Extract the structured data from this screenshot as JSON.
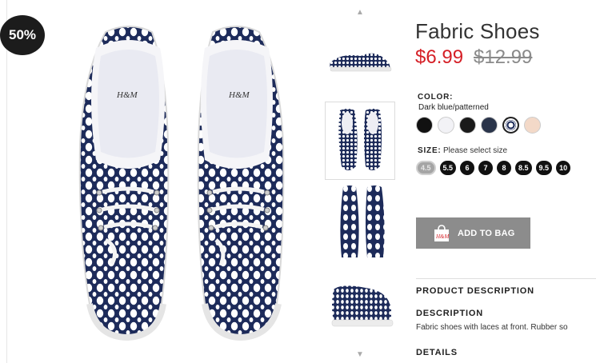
{
  "badge": {
    "label": "50%"
  },
  "product": {
    "title": "Fabric Shoes",
    "price_sale": "$6.99",
    "price_original": "$12.99"
  },
  "color": {
    "heading": "COLOR:",
    "selected_name": "Dark blue/patterned",
    "swatches": [
      "#111111",
      "#f2f2f6",
      "#1a1a1a",
      "#2a344a",
      "patterned-navy",
      "#f3d9c8"
    ]
  },
  "size": {
    "heading": "SIZE:",
    "hint": "Please select size",
    "options": [
      "4.5",
      "5.5",
      "6",
      "7",
      "8",
      "8.5",
      "9.5",
      "10"
    ]
  },
  "actions": {
    "add_to_bag_label": "ADD TO BAG",
    "bag_logo_text": "H&M"
  },
  "sections": {
    "product_description_heading": "PRODUCT DESCRIPTION",
    "description_heading": "DESCRIPTION",
    "description_text": "Fabric shoes with laces at front. Rubber so",
    "details_heading": "DETAILS"
  },
  "shoe_brand_text": "H&M",
  "colors": {
    "sale_red": "#d51f26",
    "button_gray": "#8c8c8c",
    "navy": "#1d2b5a"
  }
}
